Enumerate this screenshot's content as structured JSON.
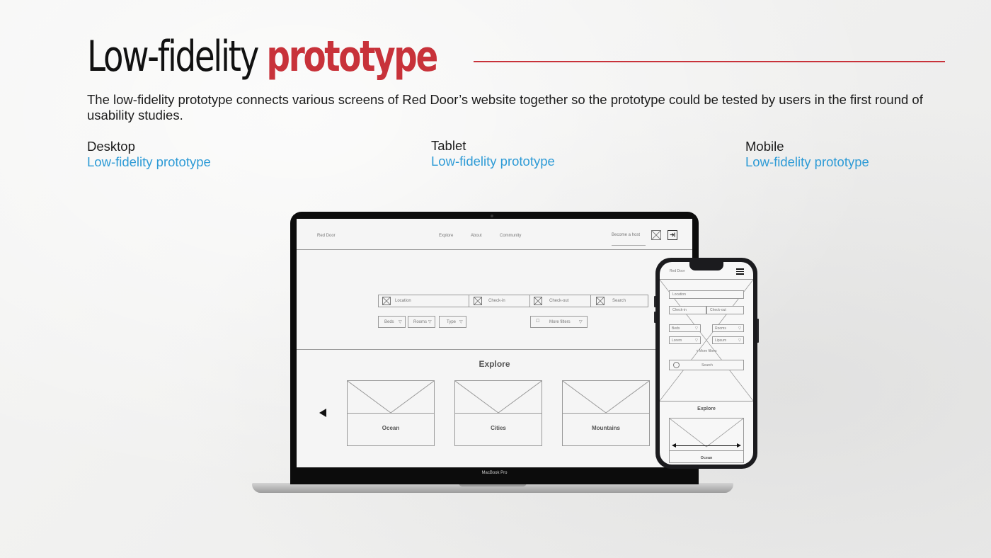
{
  "heading": {
    "part1": "Low-fidelity",
    "part2": "prototype"
  },
  "intro": "The low-fidelity prototype connects various screens of Red Door’s website together so the prototype could be tested by users in the first round of usability studies.",
  "columns": [
    {
      "title": "Desktop",
      "link": "Low-fidelity prototype"
    },
    {
      "title": "Tablet",
      "link": "Low-fidelity prototype"
    },
    {
      "title": "Mobile",
      "link": "Low-fidelity prototype"
    }
  ],
  "laptop_label": "MacBook Pro",
  "desktop": {
    "brand": "Red Door",
    "nav": [
      "Explore",
      "About",
      "Community"
    ],
    "become_host": "Become a host",
    "search_fields": [
      "Location",
      "Check-in",
      "Check-out",
      "Search"
    ],
    "filters": [
      "Beds",
      "Rooms",
      "Type"
    ],
    "more_filters": "More filters",
    "explore_title": "Explore",
    "cards": [
      "Ocean",
      "Cities",
      "Mountains"
    ]
  },
  "mobile": {
    "brand": "Red Door",
    "location": "Location",
    "check_in": "Check-in",
    "check_out": "Check-out",
    "beds": "Beds",
    "rooms": "Rooms",
    "lorem": "Lorem",
    "lipsum": "Lipsum",
    "more_filters": "+ More filters",
    "search": "Search",
    "explore_title": "Explore",
    "card": "Ocean"
  },
  "colors": {
    "accent": "#c8323a",
    "link": "#2e9bd6"
  }
}
